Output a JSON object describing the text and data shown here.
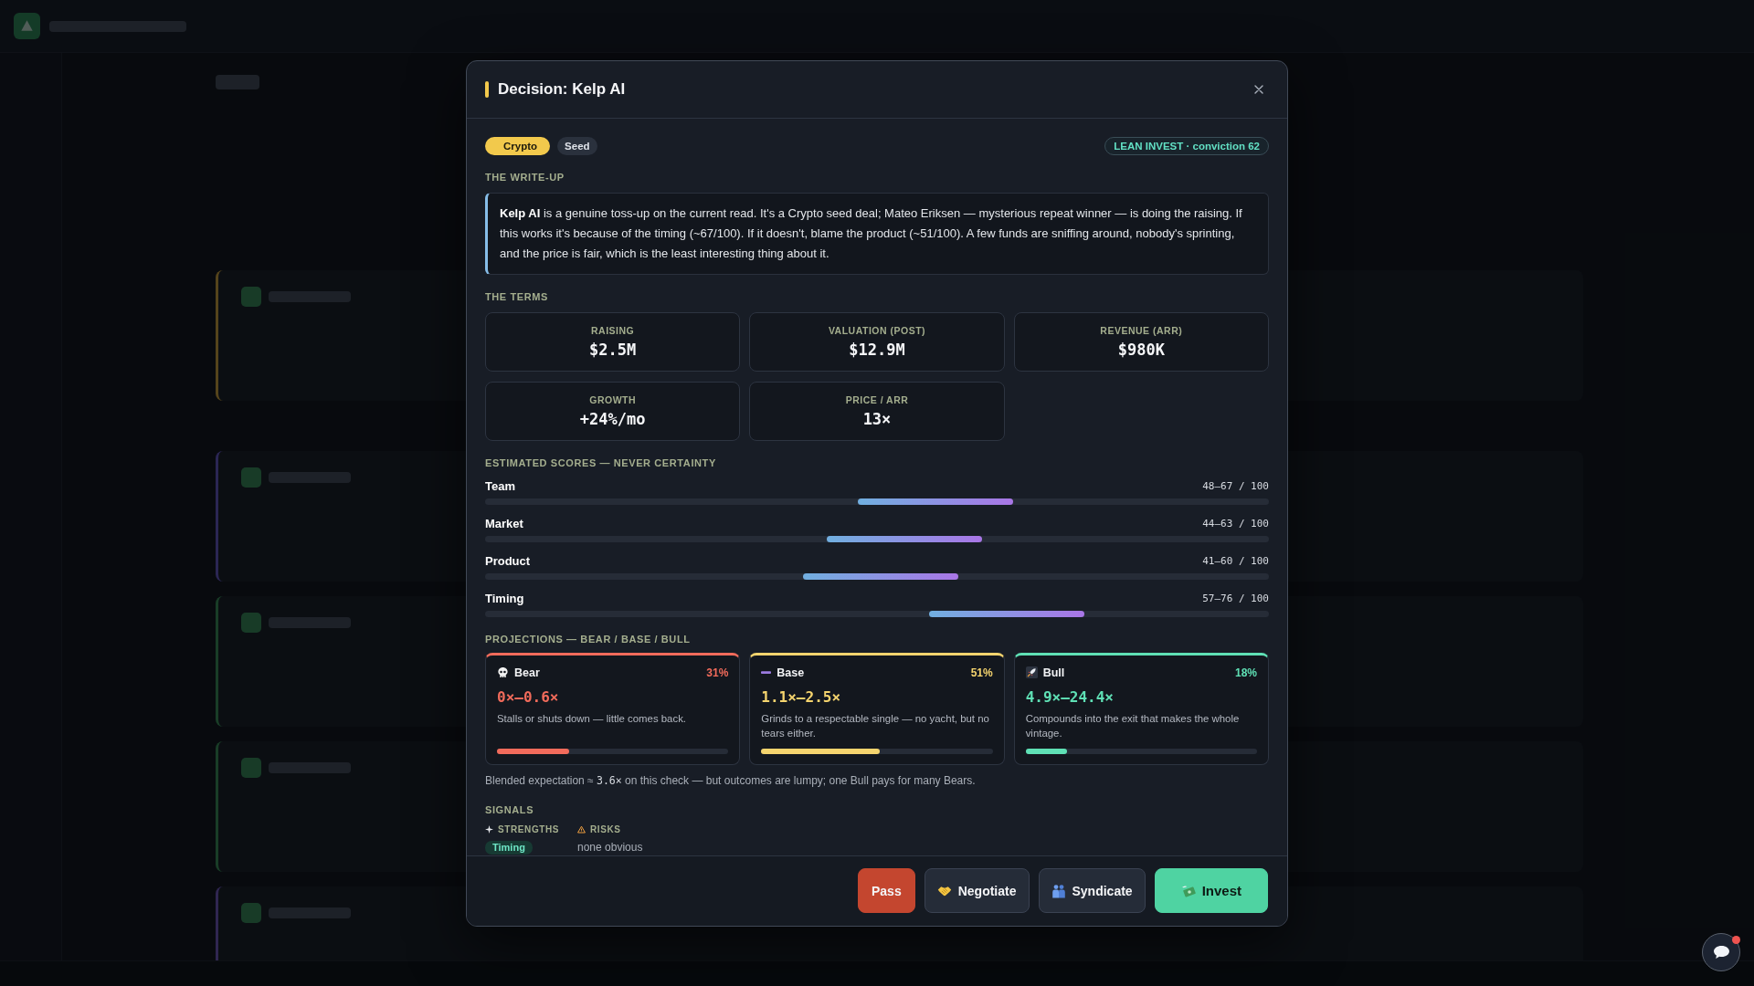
{
  "dialog": {
    "title": "Decision: Kelp AI",
    "tags": [
      {
        "kind": "sector",
        "label": "Crypto"
      },
      {
        "kind": "stage",
        "label": "Seed"
      }
    ],
    "verdict": "LEAN INVEST · conviction 62",
    "writeup": {
      "heading": "THE WRITE-UP",
      "text": "**Kelp AI** is a genuine toss-up on the current read. It's a Crypto seed deal; Mateo Eriksen — mysterious repeat winner — is doing the raising. If this works it's because of the timing (~67/100). If it doesn't, blame the product (~51/100). A few funds are sniffing around, nobody's sprinting, and the price is fair, which is the least interesting thing about it."
    },
    "terms": {
      "heading": "THE TERMS",
      "items": [
        {
          "label": "RAISING",
          "value": "$2.5M"
        },
        {
          "label": "VALUATION (POST)",
          "value": "$12.9M"
        },
        {
          "label": "REVENUE (ARR)",
          "value": "$980K"
        },
        {
          "label": "GROWTH",
          "value": "+24%/mo"
        },
        {
          "label": "PRICE / ARR",
          "value": "13×"
        }
      ]
    },
    "scores": {
      "heading": "ESTIMATED SCORES — NEVER CERTAINTY",
      "items": [
        {
          "name": "Team",
          "reading": "48–67 / 100",
          "range": {
            "from": {
              "level": 0.48
            },
            "to": {
              "level": 0.67
            }
          }
        },
        {
          "name": "Market",
          "reading": "44–63 / 100",
          "range": {
            "from": {
              "level": 0.44
            },
            "to": {
              "level": 0.63
            }
          }
        },
        {
          "name": "Product",
          "reading": "41–60 / 100",
          "range": {
            "from": {
              "level": 0.41
            },
            "to": {
              "level": 0.6
            }
          }
        },
        {
          "name": "Timing",
          "reading": "57–76 / 100",
          "range": {
            "from": {
              "level": 0.57
            },
            "to": {
              "level": 0.76
            }
          }
        }
      ]
    },
    "projections": {
      "heading": "PROJECTIONS — BEAR / BASE / BULL",
      "cases": [
        {
          "kind": "bear",
          "name": "Bear",
          "share": "31%",
          "multiple": "0×–0.6×",
          "text": "Stalls or shuts down — little comes back.",
          "level": 0.31,
          "color": "#f26b5b"
        },
        {
          "kind": "base",
          "name": "Base",
          "share": "51%",
          "multiple": "1.1×–2.5×",
          "text": "Grinds to a respectable single — no yacht, but no tears either.",
          "level": 0.51,
          "color": "#f5d46e"
        },
        {
          "kind": "bull",
          "name": "Bull",
          "share": "18%",
          "multiple": "4.9×–24.4×",
          "text": "Compounds into the exit that makes the whole vintage.",
          "level": 0.18,
          "color": "#5fe0b5"
        }
      ],
      "summary": {
        "before": "Blended expectation ≈ ",
        "value": "3.6×",
        "after": " on this check — but outcomes are lumpy; one Bull pays for many Bears."
      }
    },
    "signals": {
      "heading": "SIGNALS",
      "columns": [
        {
          "kind": "strengths",
          "label": "STRENGTHS",
          "items": [
            {
              "kind": "tag",
              "text": "Timing"
            }
          ]
        },
        {
          "kind": "risks",
          "label": "RISKS",
          "items": [
            {
              "kind": "note",
              "text": "none obvious"
            }
          ]
        }
      ]
    },
    "actions": [
      {
        "kind": "pass",
        "label": "Pass"
      },
      {
        "kind": "negotiate",
        "label": "Negotiate"
      },
      {
        "kind": "syndicate",
        "label": "Syndicate"
      },
      {
        "kind": "invest",
        "label": "Invest"
      }
    ]
  },
  "chat": {
    "unread": true
  }
}
